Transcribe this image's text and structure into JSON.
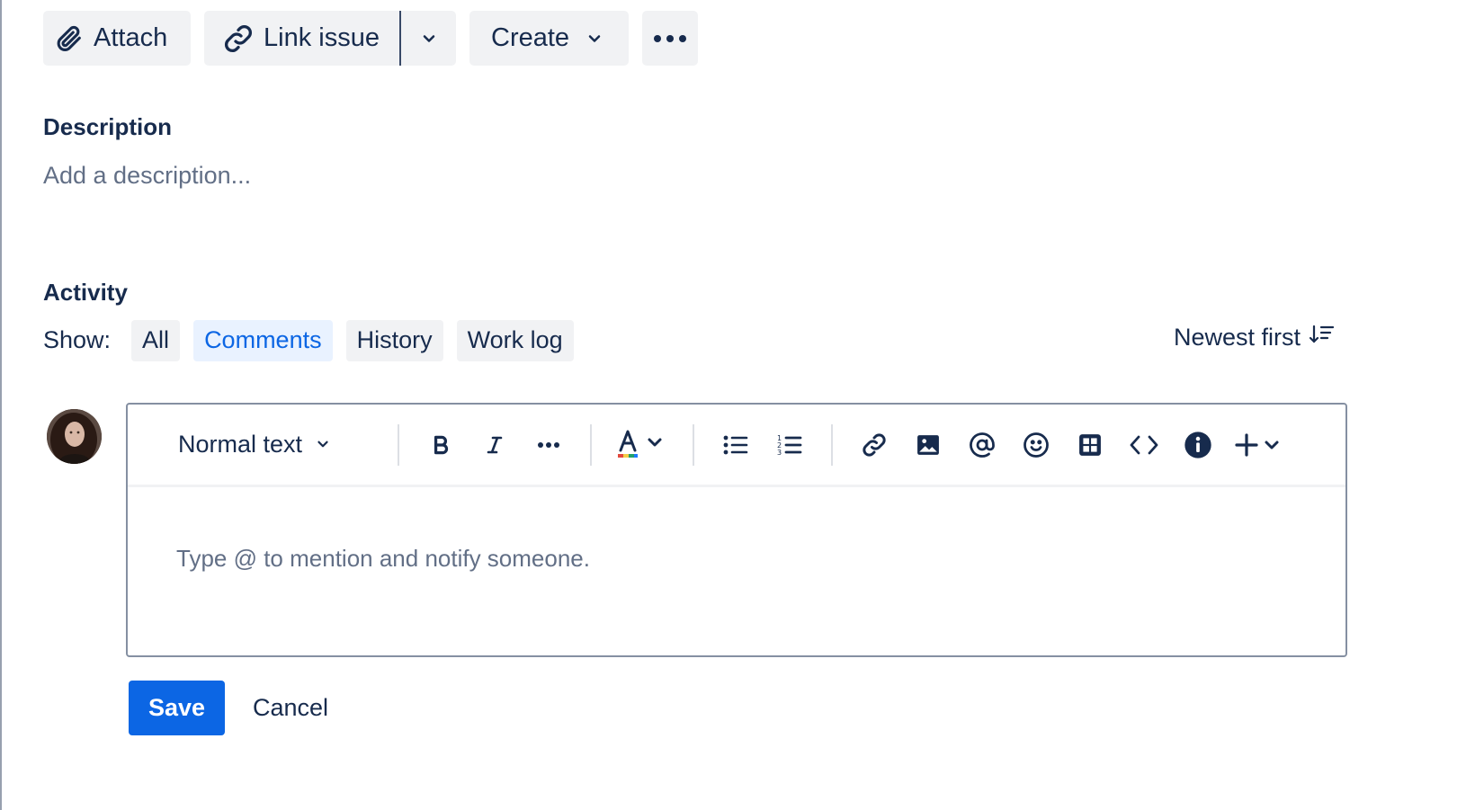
{
  "actions": {
    "attach_label": "Attach",
    "link_issue_label": "Link issue",
    "create_label": "Create"
  },
  "description": {
    "title": "Description",
    "placeholder": "Add a description..."
  },
  "activity": {
    "title": "Activity",
    "show_label": "Show:",
    "filters": [
      {
        "label": "All",
        "active": false
      },
      {
        "label": "Comments",
        "active": true
      },
      {
        "label": "History",
        "active": false
      },
      {
        "label": "Work log",
        "active": false
      }
    ],
    "sort_label": "Newest first"
  },
  "editor": {
    "text_style_label": "Normal text",
    "placeholder": "Type @ to mention and notify someone.",
    "toolbar_icons": [
      "bold-icon",
      "italic-icon",
      "more-formatting-icon",
      "text-color-icon",
      "bullet-list-icon",
      "numbered-list-icon",
      "link-icon",
      "image-icon",
      "mention-icon",
      "emoji-icon",
      "table-icon",
      "code-icon",
      "info-panel-icon",
      "insert-plus-icon"
    ]
  },
  "buttons": {
    "save_label": "Save",
    "cancel_label": "Cancel"
  },
  "colors": {
    "primary": "#0c66e4",
    "text": "#172b4d",
    "subtle_text": "#626f86",
    "chip_bg": "#f1f2f4",
    "chip_active_bg": "#e9f2ff"
  }
}
